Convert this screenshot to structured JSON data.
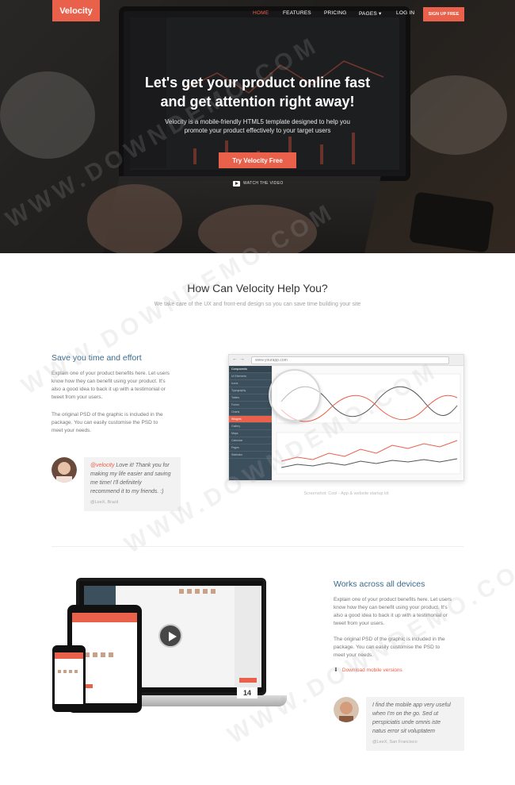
{
  "brand": {
    "name": "Velocity",
    "accent": "#e9604b"
  },
  "nav": {
    "home": "HOME",
    "features": "FEATURES",
    "pricing": "PRICING",
    "pages": "PAGES",
    "login": "LOG IN",
    "signup": "SIGN UP FREE"
  },
  "hero": {
    "title_line1": "Let's get your product online fast",
    "title_line2": "and get attention right away!",
    "subtitle_line1": "Velocity is a mobile-friendly HTML5 template designed to help you",
    "subtitle_line2": "promote your product effectively to your target users",
    "cta": "Try Velocity Free",
    "watch": "WATCH THE VIDEO"
  },
  "section": {
    "title": "How Can Velocity Help You?",
    "subtitle": "We take care of the UX and front-end design so you can save time building your site"
  },
  "feature1": {
    "title": "Save you time and effort",
    "p1_l1": "Explain one of your product benefits here. Let users",
    "p1_l2": "know how they can benefit using your product. It's",
    "p1_l3": "also a good idea to back it up with a testimonial or",
    "p1_l4": "tweet from your users.",
    "p2_l1": "The original PSD of the graphic is included in the",
    "p2_l2": "package. You can easily customise the PSD to",
    "p2_l3": "meet your needs.",
    "browser_url": "www.yourapp.com",
    "browser_sidebar": [
      "Components",
      "UI Elements",
      "Icons",
      "Typography",
      "Tables",
      "Forms",
      "Charts",
      "Widgets",
      "Gallery",
      "Maps",
      "Calendar",
      "Pages",
      "Statistics"
    ],
    "caption": "Screenshot: Cool - App & website startup kit",
    "testimonial": {
      "handle": "@velocity",
      "text_a": " Love it! Thank you for",
      "text_l2": "making my life easier and saving",
      "text_l3": "me time! I'll definitely",
      "text_l4": "recommend it to my friends. :)",
      "author": "@LeeX, Brazil"
    }
  },
  "feature2": {
    "title": "Works across all devices",
    "p1_l1": "Explain one of your product benefits here. Let users",
    "p1_l2": "know how they can benefit using your product. It's",
    "p1_l3": "also a good idea to back it up with a testimonial or",
    "p1_l4": "tweet from your users.",
    "p2_l1": "The original PSD of the graphic is included in the",
    "p2_l2": "package. You can easily customise the PSD to",
    "p2_l3": "meet your needs.",
    "download": "Download mobile versions",
    "badge": "14",
    "testimonial": {
      "text_l1": "I find the mobile app very useful",
      "text_l2": "when I'm on the go. Sed ut",
      "text_l3": "perspiciatis unde omnis iste",
      "text_l4": "natus error sit voluptatem",
      "author": "@LeeX, San Francisco"
    }
  },
  "watermark": "WWW.DOWNDEMO.COM"
}
